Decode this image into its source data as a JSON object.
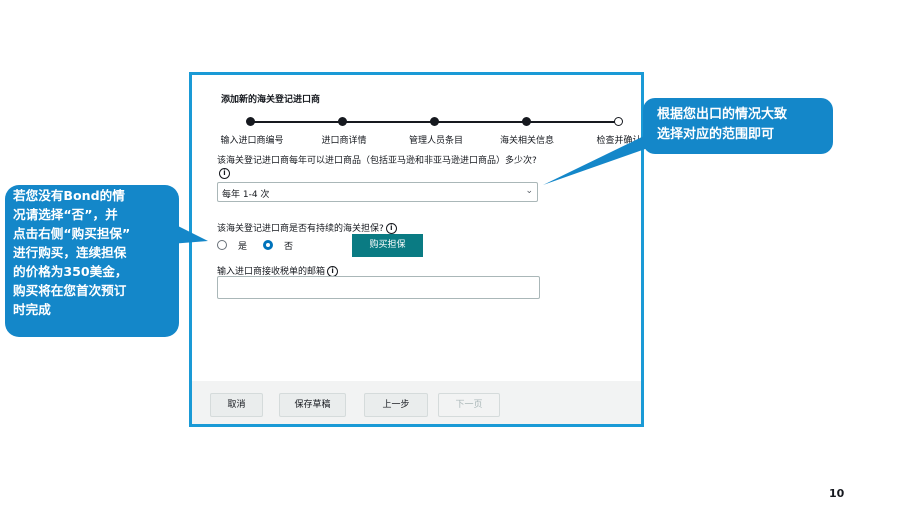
{
  "form": {
    "title": "添加新的海关登记进口商",
    "steps": [
      {
        "label": "输入进口商编号"
      },
      {
        "label": "进口商详情"
      },
      {
        "label": "管理人员条目"
      },
      {
        "label": "海关相关信息"
      },
      {
        "label": "检查并确认"
      }
    ],
    "import_frequency": {
      "question": "该海关登记进口商每年可以进口商品（包括亚马逊和非亚马逊进口商品）多少次?",
      "selected": "每年 1-4 次"
    },
    "bond": {
      "question": "该海关登记进口商是否有持续的海关担保?",
      "options": [
        "是",
        "否"
      ],
      "selected_index": 1,
      "buy_label": "购买担保"
    },
    "email": {
      "label": "输入进口商接收税单的邮箱",
      "value": ""
    },
    "info_icon": "i",
    "chevron": "⌄",
    "footer": {
      "cancel": "取消",
      "save_draft": "保存草稿",
      "previous": "上一步",
      "next": "下一页"
    }
  },
  "callouts": {
    "left_lines": [
      "若您没有Bond的情",
      "况请选择“否”，并",
      "点击右侧“购买担保”",
      "进行购买，连续担保",
      "的价格为350美金，",
      "购买将在您首次预订",
      "时完成"
    ],
    "right_lines": [
      "根据您出口的情况大致",
      "选择对应的范围即可"
    ]
  },
  "page_number": "10",
  "colors": {
    "frame_border": "#1a9ad6",
    "callout_bg": "#1487c9",
    "primary_button": "#0a7b83",
    "radio_selected": "#0073bb"
  }
}
